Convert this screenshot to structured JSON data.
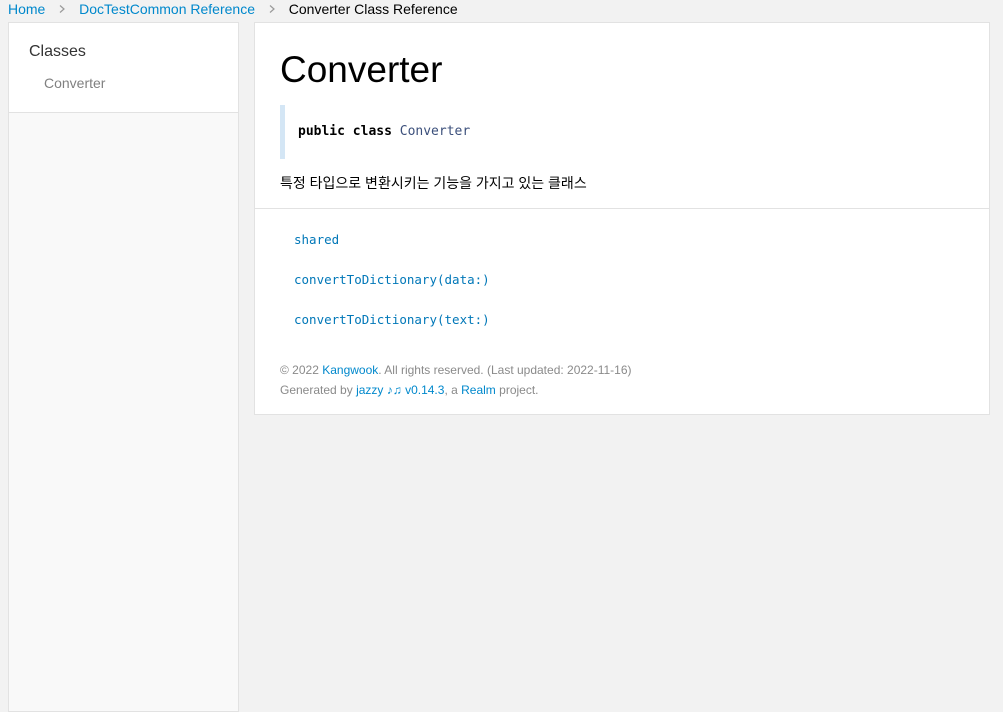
{
  "breadcrumb": {
    "home": "Home",
    "module": "DocTestCommon Reference",
    "current": "Converter Class Reference"
  },
  "sidebar": {
    "group_title": "Classes",
    "items": [
      {
        "label": "Converter"
      }
    ]
  },
  "main": {
    "title": "Converter",
    "declaration": {
      "keywords": "public class",
      "type_name": "Converter"
    },
    "abstract": "특정 타입으로 변환시키는 기능을 가지고 있는 클래스",
    "tasks": [
      {
        "label": "shared"
      },
      {
        "label": "convertToDictionary(data:)"
      },
      {
        "label": "convertToDictionary(text:)"
      }
    ]
  },
  "footer": {
    "copyright_prefix": "© 2022 ",
    "author": "Kangwook",
    "copyright_suffix": ". All rights reserved. (Last updated: 2022-11-16)",
    "generated_prefix": "Generated by ",
    "generator": "jazzy ♪♫ v0.14.3",
    "generated_mid": ", a ",
    "org": "Realm",
    "generated_suffix": " project."
  },
  "colors": {
    "link": "#0088cc",
    "background": "#f2f2f2",
    "declaration_border": "#d4e6f5"
  },
  "icons": {
    "breadcrumb_separator": "chevron-right-icon"
  }
}
